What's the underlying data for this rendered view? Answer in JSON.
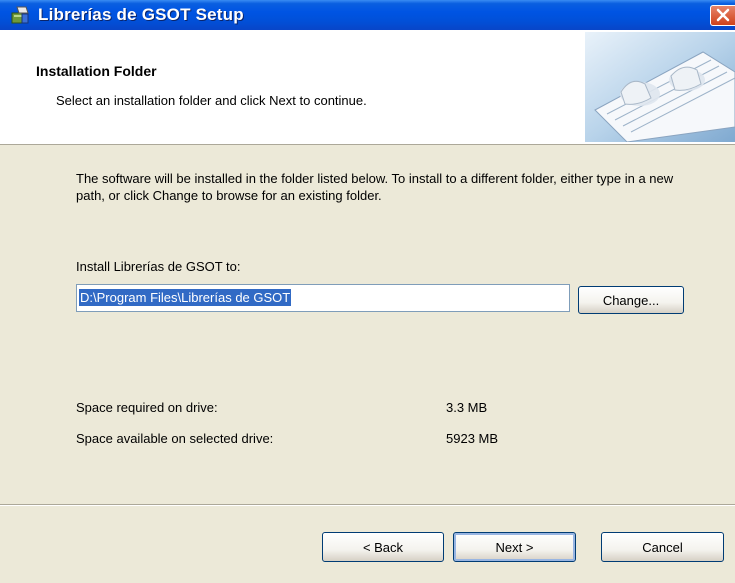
{
  "window": {
    "title": "Librerías de GSOT Setup"
  },
  "header": {
    "title": "Installation Folder",
    "subtitle": "Select an installation folder and click Next to continue."
  },
  "body": {
    "description": "The software will be installed in the folder listed below. To install to a different folder, either type in a new path, or click Change to browse for an existing folder.",
    "install_label": "Install Librerías de GSOT to:",
    "install_path": "D:\\Program Files\\Librerías de GSOT",
    "change_label": "Change...",
    "space_required_label": "Space required on drive:",
    "space_required_value": "3.3 MB",
    "space_available_label": "Space available on selected drive:",
    "space_available_value": "5923 MB"
  },
  "footer": {
    "back_label": "< Back",
    "next_label": "Next >",
    "cancel_label": "Cancel"
  }
}
